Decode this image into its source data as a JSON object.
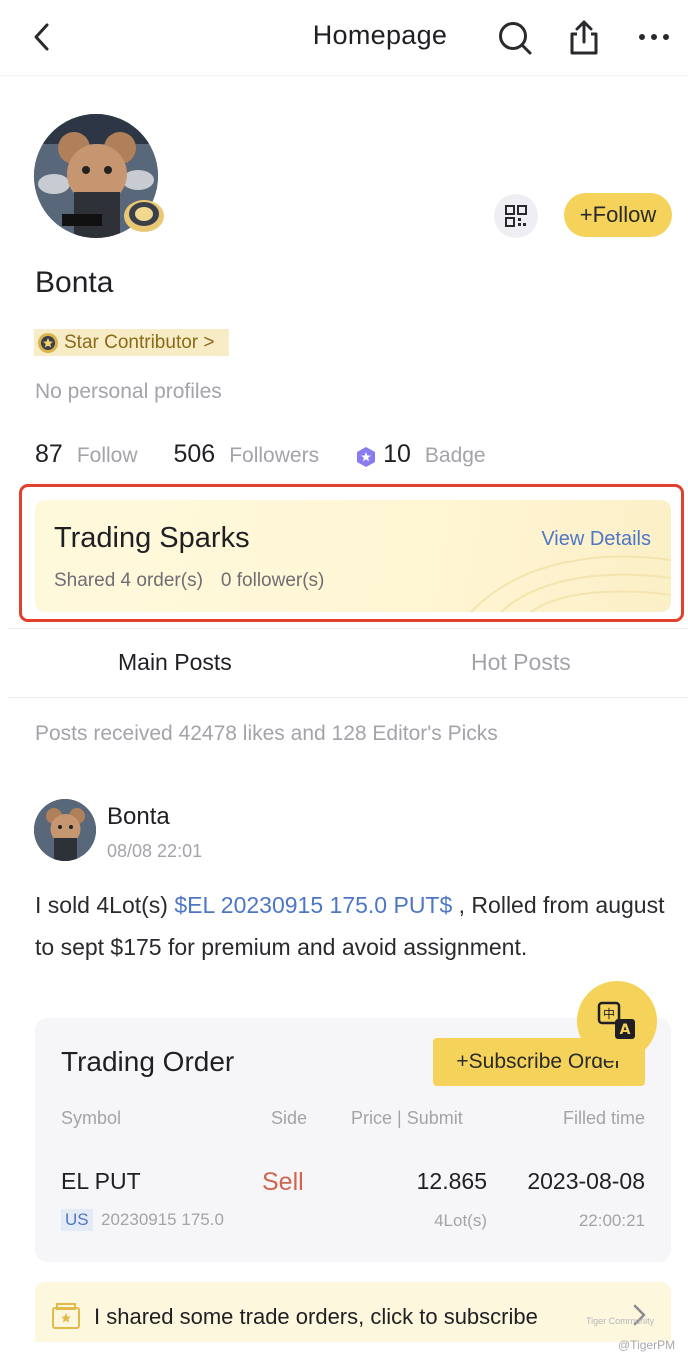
{
  "header": {
    "title": "Homepage",
    "back_icon": "chevron-left-icon",
    "search_icon": "search-icon",
    "share_icon": "share-icon",
    "more_icon": "more-dots-icon"
  },
  "profile": {
    "name": "Bonta",
    "follow_button": "+Follow",
    "contributor_badge": "Star Contributor >",
    "bio": "No personal profiles",
    "stats": {
      "follow_count": "87",
      "follow_label": "Follow",
      "followers_count": "506",
      "followers_label": "Followers",
      "badge_count": "10",
      "badge_label": "Badge"
    }
  },
  "sparks": {
    "title": "Trading Sparks",
    "shared": "Shared 4 order(s)",
    "followers": "0 follower(s)",
    "link": "View Details"
  },
  "tabs": [
    {
      "label": "Main Posts",
      "active": true
    },
    {
      "label": "Hot Posts",
      "active": false
    }
  ],
  "likes_summary": "Posts received 42478 likes and 128 Editor's Picks",
  "post": {
    "author": "Bonta",
    "time": "08/08 22:01",
    "text_before": "I sold 4Lot(s) ",
    "ticker_link": "$EL 20230915 175.0 PUT$",
    "text_after": " , Rolled from august to sept $175 for premium and avoid assignment."
  },
  "order_card": {
    "title": "Trading Order",
    "subscribe_button": "+Subscribe Order",
    "columns": [
      "Symbol",
      "Side",
      "Price | Submit",
      "Filled time"
    ],
    "row": {
      "symbol": "EL PUT",
      "market": "US",
      "contract": "20230915 175.0",
      "side": "Sell",
      "price": "12.865",
      "quantity": "4Lot(s)",
      "filled_date": "2023-08-08",
      "filled_time": "22:00:21"
    }
  },
  "banner": {
    "text": "I shared some trade orders, click to subscribe"
  },
  "watermark": {
    "line1": "Tiger Community",
    "line2": "@TigerPM"
  },
  "colors": {
    "accent_yellow": "#f5d35a",
    "link_blue": "#4d77c6",
    "sell_red": "#d0654f",
    "highlight_outline": "#e0402c"
  }
}
